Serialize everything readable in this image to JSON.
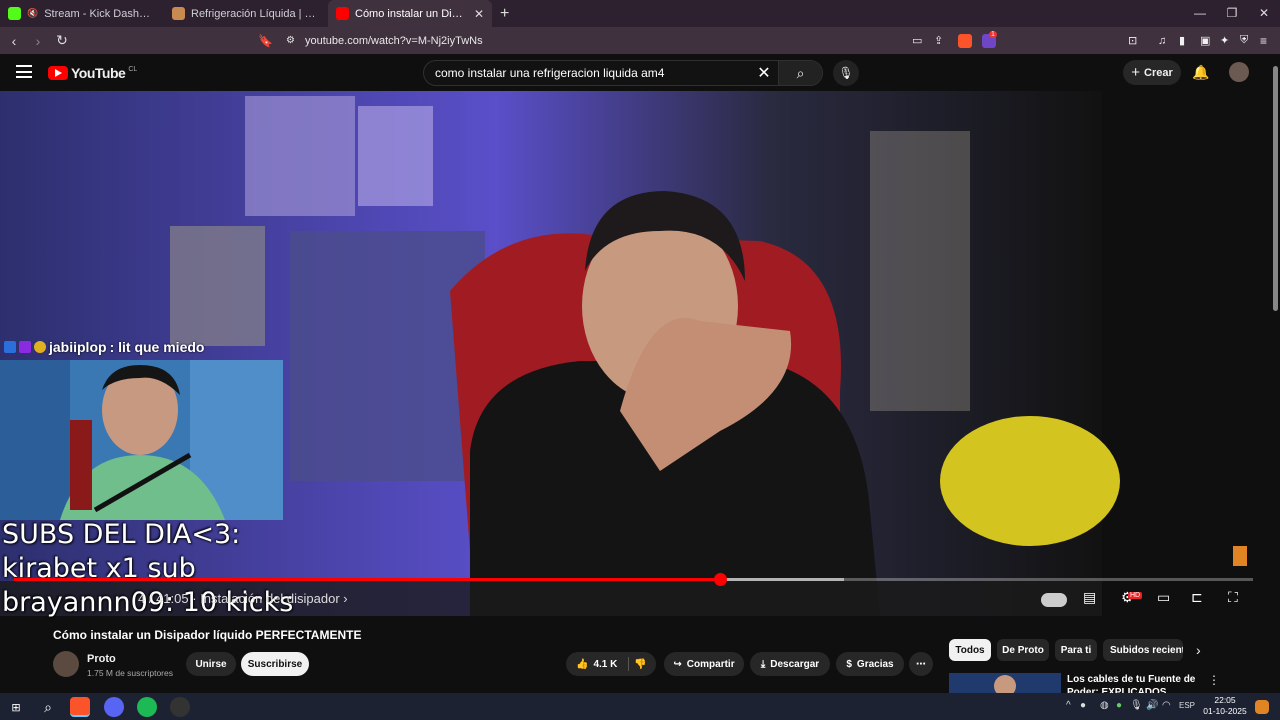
{
  "browser": {
    "tabs": [
      {
        "title": "Stream - Kick Dashboard",
        "icon": "kick-icon",
        "color": "#53fc18"
      },
      {
        "title": "Refrigeración Líquida | SoloTodo.cl",
        "icon": "solotodo-icon",
        "color": "#e0a060"
      },
      {
        "title": "Cómo instalar un Disipador líquido",
        "icon": "youtube-icon",
        "color": "#ff0000",
        "active": true
      }
    ],
    "url": "youtube.com/watch?v=M-Nj2iyTwNs",
    "ext_badge": "1"
  },
  "youtube": {
    "logo_text": "YouTube",
    "country": "CL",
    "search_query": "como instalar una refrigeracion liquida am4",
    "create_label": "Crear"
  },
  "player": {
    "progress": 0.57,
    "chat": {
      "user": "jabiiplop",
      "message": ": lit que miedo"
    },
    "subs_overlay": [
      "SUBS DEL DIA<3:",
      "kirabet x1 sub",
      "brayannn09: 10 kicks"
    ],
    "time": "4 / 41:05",
    "chapter": "Instalación del disipador",
    "quality_badge": "HD"
  },
  "video": {
    "title": "Cómo instalar un Disipador líquido PERFECTAMENTE",
    "channel": "Proto",
    "subscribers": "1.75 M de suscriptores",
    "join_label": "Unirse",
    "subscribe_label": "Suscribirse",
    "likes": "4.1 K",
    "share_label": "Compartir",
    "download_label": "Descargar",
    "thanks_label": "Gracias"
  },
  "chips": [
    "Todos",
    "De Proto",
    "Para ti",
    "Subidos recientes"
  ],
  "recommendation": {
    "title": "Los cables de tu Fuente de Poder: EXPLICADOS"
  },
  "taskbar": {
    "lang": "ESP",
    "time": "22:05",
    "date": "01-10-2025"
  }
}
